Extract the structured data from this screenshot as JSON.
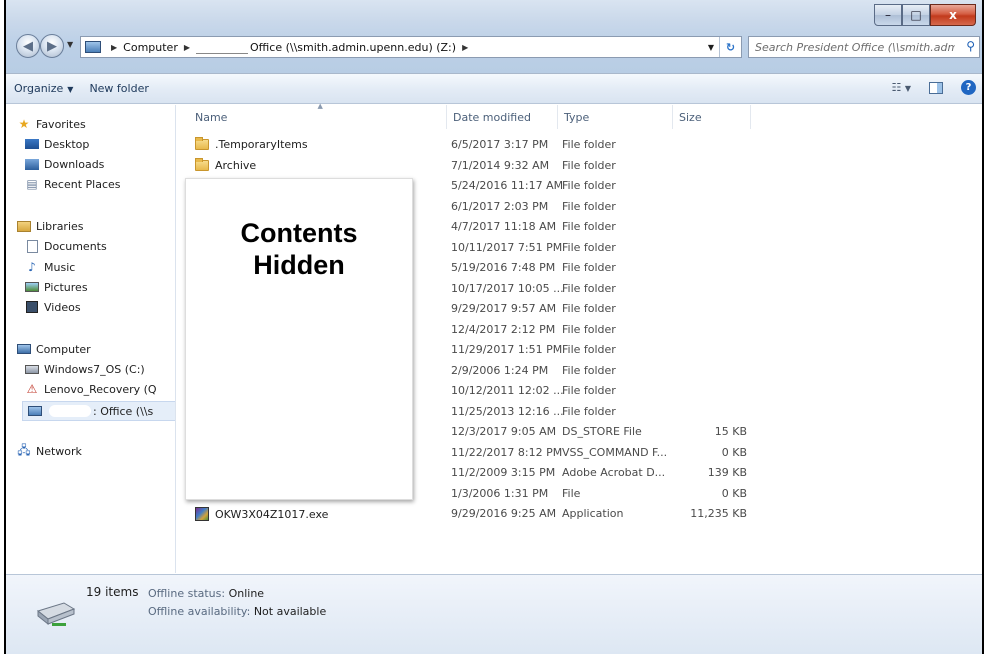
{
  "window": {
    "breadcrumb": [
      "Computer",
      "Office (\\\\smith.admin.upenn.edu) (Z:)"
    ],
    "search_placeholder": "Search President Office (\\\\smith.admi...",
    "caption": {
      "minimize": "–",
      "maximize": "□",
      "close": "x"
    }
  },
  "toolbar": {
    "organize": "Organize",
    "new_folder": "New folder"
  },
  "navpane": {
    "favorites": "Favorites",
    "desktop": "Desktop",
    "downloads": "Downloads",
    "recent": "Recent Places",
    "libraries": "Libraries",
    "documents": "Documents",
    "music": "Music",
    "pictures": "Pictures",
    "videos": "Videos",
    "computer": "Computer",
    "drive_c": "Windows7_OS (C:)",
    "drive_q": "Lenovo_Recovery (Q",
    "drive_z": ": Office (\\\\s",
    "network": "Network"
  },
  "columns": {
    "name": "Name",
    "date": "Date modified",
    "type": "Type",
    "size": "Size"
  },
  "files": [
    {
      "name": ".TemporaryItems",
      "date": "6/5/2017 3:17 PM",
      "type": "File folder",
      "size": "",
      "icon": "folder"
    },
    {
      "name": "Archive",
      "date": "7/1/2014 9:32 AM",
      "type": "File folder",
      "size": "",
      "icon": "folder"
    },
    {
      "name": "",
      "date": "5/24/2016 11:17 AM",
      "type": "File folder",
      "size": "",
      "icon": "none"
    },
    {
      "name": "",
      "date": "6/1/2017 2:03 PM",
      "type": "File folder",
      "size": "",
      "icon": "none"
    },
    {
      "name": "",
      "date": "4/7/2017 11:18 AM",
      "type": "File folder",
      "size": "",
      "icon": "none"
    },
    {
      "name": "",
      "date": "10/11/2017 7:51 PM",
      "type": "File folder",
      "size": "",
      "icon": "none"
    },
    {
      "name": "",
      "date": "5/19/2016 7:48 PM",
      "type": "File folder",
      "size": "",
      "icon": "none"
    },
    {
      "name": "",
      "date": "10/17/2017 10:05 ...",
      "type": "File folder",
      "size": "",
      "icon": "none"
    },
    {
      "name": "",
      "date": "9/29/2017 9:57 AM",
      "type": "File folder",
      "size": "",
      "icon": "none"
    },
    {
      "name": "",
      "date": "12/4/2017 2:12 PM",
      "type": "File folder",
      "size": "",
      "icon": "none"
    },
    {
      "name": "",
      "date": "11/29/2017 1:51 PM",
      "type": "File folder",
      "size": "",
      "icon": "none"
    },
    {
      "name": "",
      "date": "2/9/2006 1:24 PM",
      "type": "File folder",
      "size": "",
      "icon": "none"
    },
    {
      "name": "",
      "date": "10/12/2011 12:02 ...",
      "type": "File folder",
      "size": "",
      "icon": "none"
    },
    {
      "name": "",
      "date": "11/25/2013 12:16 ...",
      "type": "File folder",
      "size": "",
      "icon": "none"
    },
    {
      "name": "",
      "date": "12/3/2017 9:05 AM",
      "type": "DS_STORE File",
      "size": "15 KB",
      "icon": "none"
    },
    {
      "name": "",
      "date": "11/22/2017 8:12 PM",
      "type": "VSS_COMMAND F...",
      "size": "0 KB",
      "icon": "none"
    },
    {
      "name": "",
      "date": "11/2/2009 3:15 PM",
      "type": "Adobe Acrobat D...",
      "size": "139 KB",
      "icon": "none"
    },
    {
      "name": "",
      "date": "1/3/2006 1:31 PM",
      "type": "File",
      "size": "0 KB",
      "icon": "none"
    },
    {
      "name": "OKW3X04Z1017.exe",
      "date": "9/29/2016 9:25 AM",
      "type": "Application",
      "size": "11,235 KB",
      "icon": "exe"
    }
  ],
  "overlay": {
    "text": "Contents\nHidden"
  },
  "details": {
    "count": "19 items",
    "offline_status_label": "Offline status:",
    "offline_status_value": "Online",
    "offline_avail_label": "Offline availability:",
    "offline_avail_value": "Not available"
  },
  "colors": {
    "accent": "#1e395b",
    "chrome": "#bcd0e7",
    "close": "#c23a1c"
  }
}
